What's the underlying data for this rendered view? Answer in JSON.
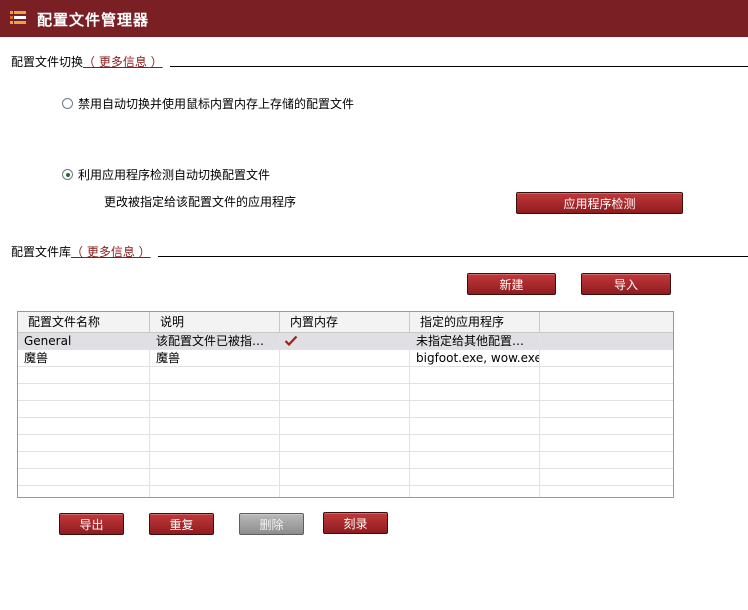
{
  "window": {
    "title": "配置文件管理器"
  },
  "switch_section": {
    "label": "配置文件切换",
    "more_link": "（ 更多信息 ）",
    "option_disable": "禁用自动切换并使用鼠标内置内存上存储的配置文件",
    "option_auto": "利用应用程序检测自动切换配置文件",
    "selected_option": "option_auto",
    "change_app_text": "更改被指定给该配置文件的应用程序",
    "detect_button": "应用程序检测"
  },
  "library_section": {
    "label": "配置文件库",
    "more_link": "（ 更多信息 ）",
    "new_button": "新建",
    "import_button": "导入"
  },
  "table": {
    "columns": [
      "配置文件名称",
      "说明",
      "内置内存",
      "指定的应用程序"
    ],
    "rows": [
      {
        "name": "General",
        "desc": "该配置文件已被指…",
        "onboard": true,
        "apps": "未指定给其他配置…",
        "selected": true
      },
      {
        "name": "魔兽",
        "desc": "魔兽",
        "onboard": false,
        "apps": "bigfoot.exe, wow.exe",
        "selected": false
      }
    ]
  },
  "actions": {
    "export_button": "导出",
    "duplicate_button": "重复",
    "delete_button": "删除",
    "burn_button": "刻录",
    "delete_disabled": true
  },
  "colors": {
    "titlebar": "#7a1f23",
    "button": "#b02a2d",
    "check": "#a0201f"
  }
}
